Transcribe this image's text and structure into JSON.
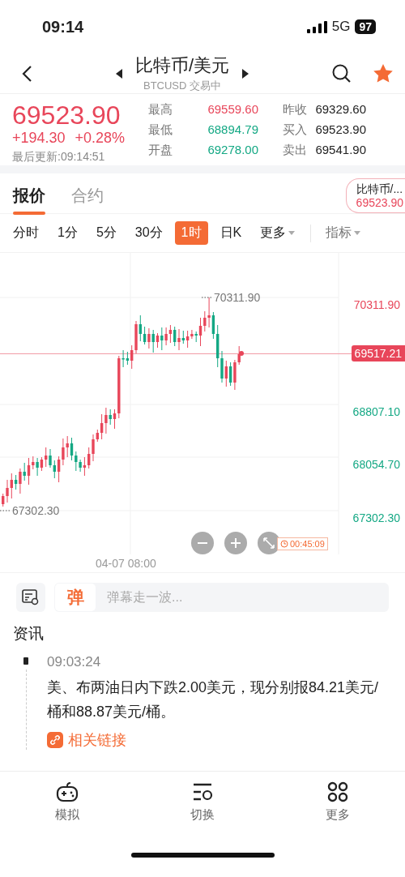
{
  "status_bar": {
    "time": "09:14",
    "network": "5G",
    "battery": "97"
  },
  "header": {
    "title": "比特币/美元",
    "subtitle": "BTCUSD 交易中",
    "favorite": true
  },
  "quote": {
    "price": "69523.90",
    "change": "+194.30",
    "change_pct": "+0.28%",
    "updated": "最后更新:09:14:51",
    "stats": [
      {
        "label": "最高",
        "value": "69559.60",
        "color": "#e8465a"
      },
      {
        "label": "昨收",
        "value": "69329.60",
        "color": "#222222"
      },
      {
        "label": "最低",
        "value": "68894.79",
        "color": "#14a884"
      },
      {
        "label": "买入",
        "value": "69523.90",
        "color": "#222222"
      },
      {
        "label": "开盘",
        "value": "69278.00",
        "color": "#14a884"
      },
      {
        "label": "卖出",
        "value": "69541.90",
        "color": "#222222"
      }
    ]
  },
  "tabs": [
    {
      "label": "报价",
      "selected": true
    },
    {
      "label": "合约",
      "selected": false
    }
  ],
  "mini_quote": {
    "name": "比特币/...",
    "price": "69523.90"
  },
  "periods": [
    {
      "label": "分时",
      "selected": false,
      "kind": "plain"
    },
    {
      "label": "1分",
      "selected": false,
      "kind": "plain"
    },
    {
      "label": "5分",
      "selected": false,
      "kind": "plain"
    },
    {
      "label": "30分",
      "selected": false,
      "kind": "plain"
    },
    {
      "label": "1时",
      "selected": true,
      "kind": "plain"
    },
    {
      "label": "日K",
      "selected": false,
      "kind": "plain"
    },
    {
      "label": "更多",
      "selected": false,
      "kind": "menu"
    }
  ],
  "indicator_menu": "指标",
  "chart": {
    "price_labels": [
      {
        "text": "70311.90",
        "color": "#e8465a"
      },
      {
        "text": "68807.10",
        "color": "#14a884"
      },
      {
        "text": "68054.70",
        "color": "#14a884"
      },
      {
        "text": "67302.30",
        "color": "#14a884"
      }
    ],
    "current_price": "69517.21",
    "high_marker": "70311.90",
    "low_marker": "67302.30",
    "date_label": "04-07 08:00",
    "countdown": "00:45:09"
  },
  "danmaku": {
    "badge": "弹",
    "placeholder": "弹幕走一波..."
  },
  "news": {
    "title": "资讯",
    "items": [
      {
        "time": "09:03:24",
        "text": "美、布两油日内下跌2.00美元，现分别报84.21美元/桶和88.87美元/桶。",
        "link": "相关链接"
      }
    ]
  },
  "bottom_nav": [
    {
      "label": "模拟"
    },
    {
      "label": "切换"
    },
    {
      "label": "更多"
    }
  ]
}
